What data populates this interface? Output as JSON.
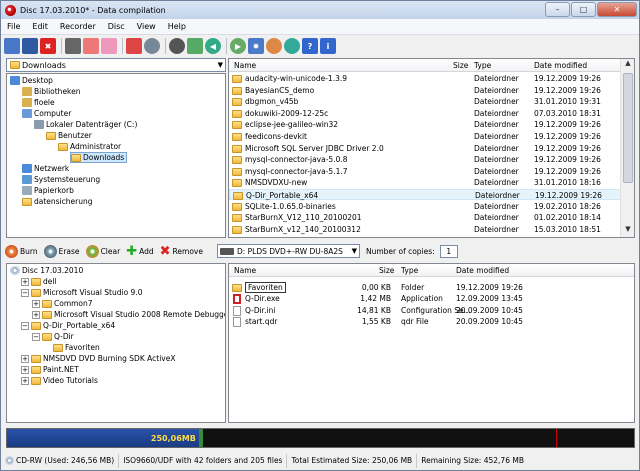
{
  "window": {
    "title": "Disc 17.03.2010* - Data compilation"
  },
  "menu": [
    "File",
    "Edit",
    "Recorder",
    "Disc",
    "View",
    "Help"
  ],
  "toolbar_icons": [
    "new-icon",
    "save-icon",
    "delete-icon",
    "print-icon",
    "add-files-icon",
    "add-folder-icon",
    "remove-icon",
    "burn-icon",
    "erase-icon",
    "copy-icon",
    "back-icon",
    "forward-icon",
    "settings-icon",
    "globe-icon",
    "web-icon",
    "help-icon",
    "info-icon"
  ],
  "source": {
    "combo": "Downloads",
    "tree": [
      {
        "label": "Desktop",
        "level": 0,
        "icon": "desktop-icon"
      },
      {
        "label": "Bibliotheken",
        "level": 1,
        "icon": "library-icon"
      },
      {
        "label": "floele",
        "level": 1,
        "icon": "user-icon"
      },
      {
        "label": "Computer",
        "level": 1,
        "icon": "computer-icon"
      },
      {
        "label": "Lokaler Datenträger (C:)",
        "level": 2,
        "icon": "drive-icon"
      },
      {
        "label": "Benutzer",
        "level": 3,
        "icon": "folder-icon"
      },
      {
        "label": "Administrator",
        "level": 4,
        "icon": "folder-icon"
      },
      {
        "label": "Downloads",
        "level": 5,
        "icon": "folder-icon"
      },
      {
        "label": "Netzwerk",
        "level": 1,
        "icon": "network-icon"
      },
      {
        "label": "Systemsteuerung",
        "level": 1,
        "icon": "control-panel-icon"
      },
      {
        "label": "Papierkorb",
        "level": 1,
        "icon": "recycle-bin-icon"
      },
      {
        "label": "datensicherung",
        "level": 1,
        "icon": "folder-icon"
      }
    ],
    "columns": {
      "name": "Name",
      "size": "Size",
      "type": "Type",
      "modified": "Date modified"
    },
    "files": [
      {
        "name": "audacity-win-unicode-1.3.9",
        "type": "Dateiordner",
        "modified": "19.12.2009 19:26"
      },
      {
        "name": "BayesianCS_demo",
        "type": "Dateiordner",
        "modified": "19.12.2009 19:26"
      },
      {
        "name": "dbgmon_v45b",
        "type": "Dateiordner",
        "modified": "31.01.2010 19:31"
      },
      {
        "name": "dokuwiki-2009-12-25c",
        "type": "Dateiordner",
        "modified": "07.03.2010 18:31"
      },
      {
        "name": "eclipse-jee-galileo-win32",
        "type": "Dateiordner",
        "modified": "19.12.2009 19:26"
      },
      {
        "name": "feedicons-devkit",
        "type": "Dateiordner",
        "modified": "19.12.2009 19:26"
      },
      {
        "name": "Microsoft SQL Server JDBC Driver 2.0",
        "type": "Dateiordner",
        "modified": "19.12.2009 19:26"
      },
      {
        "name": "mysql-connector-java-5.0.8",
        "type": "Dateiordner",
        "modified": "19.12.2009 19:26"
      },
      {
        "name": "mysql-connector-java-5.1.7",
        "type": "Dateiordner",
        "modified": "19.12.2009 19:26"
      },
      {
        "name": "NMSDVDXU-new",
        "type": "Dateiordner",
        "modified": "31.01.2010 18:16"
      },
      {
        "name": "Q-Dir_Portable_x64",
        "type": "Dateiordner",
        "modified": "19.12.2009 19:26"
      },
      {
        "name": "SQLite-1.0.65.0-binaries",
        "type": "Dateiordner",
        "modified": "19.02.2010 18:26"
      },
      {
        "name": "StarBurnX_V12_110_20100201",
        "type": "Dateiordner",
        "modified": "01.02.2010 18:14"
      },
      {
        "name": "StarBurnX_v12_140_20100312",
        "type": "Dateiordner",
        "modified": "15.03.2010 18:51"
      }
    ]
  },
  "middle": {
    "burn": "Burn",
    "erase": "Erase",
    "clear": "Clear",
    "add": "Add",
    "remove": "Remove",
    "drive": "D: PLDS DVD+-RW DU-8A2S",
    "copies_label": "Number of copies:",
    "copies_value": "1"
  },
  "project": {
    "tree": [
      {
        "label": "Disc 17.03.2010",
        "level": 0,
        "exp": "",
        "icon": "disc-icon"
      },
      {
        "label": "dell",
        "level": 1,
        "exp": "+",
        "icon": "folder-icon"
      },
      {
        "label": "Microsoft Visual Studio 9.0",
        "level": 1,
        "exp": "−",
        "icon": "folder-icon"
      },
      {
        "label": "Common7",
        "level": 2,
        "exp": "+",
        "icon": "folder-icon"
      },
      {
        "label": "Microsoft Visual Studio 2008 Remote Debugger",
        "level": 2,
        "exp": "+",
        "icon": "folder-icon"
      },
      {
        "label": "Q-Dir_Portable_x64",
        "level": 1,
        "exp": "−",
        "icon": "folder-icon"
      },
      {
        "label": "Q-Dir",
        "level": 2,
        "exp": "−",
        "icon": "folder-icon"
      },
      {
        "label": "Favoriten",
        "level": 3,
        "exp": "",
        "icon": "folder-icon"
      },
      {
        "label": "NMSDVD DVD Burning SDK ActiveX",
        "level": 1,
        "exp": "+",
        "icon": "folder-icon"
      },
      {
        "label": "Paint.NET",
        "level": 1,
        "exp": "+",
        "icon": "folder-icon"
      },
      {
        "label": "Video Tutorials",
        "level": 1,
        "exp": "+",
        "icon": "folder-icon"
      }
    ],
    "columns": {
      "name": "Name",
      "size": "Size",
      "type": "Type",
      "modified": "Date modified"
    },
    "files": [
      {
        "name": "Favoriten",
        "size": "0,00 KB",
        "type": "Folder",
        "modified": "19.12.2009 19:26",
        "icon": "folder-icon"
      },
      {
        "name": "Q-Dir.exe",
        "size": "1,42 MB",
        "type": "Application",
        "modified": "12.09.2009 13:45",
        "icon": "app-icon"
      },
      {
        "name": "Q-Dir.ini",
        "size": "14,81 KB",
        "type": "Configuration Se...",
        "modified": "20.09.2009 10:45",
        "icon": "ini-icon"
      },
      {
        "name": "start.qdr",
        "size": "1,55 KB",
        "type": "qdr File",
        "modified": "20.09.2009 10:45",
        "icon": "file-icon"
      }
    ]
  },
  "capacity": {
    "label": "250,06MB",
    "fraction": 0.306,
    "green_end": 0.312,
    "red_mark": 0.875
  },
  "status": {
    "media": "CD-RW (Used: 246,56 MB)",
    "fs": "ISO9660/UDF with 42 folders and 205 files",
    "total": "Total Estimated Size: 250,06 MB",
    "remaining": "Remaining Size: 452,76 MB"
  },
  "colors": {
    "capacity_fill": "#2a52a8",
    "capacity_text": "#ffdd44",
    "selection": "#cce8ff"
  }
}
